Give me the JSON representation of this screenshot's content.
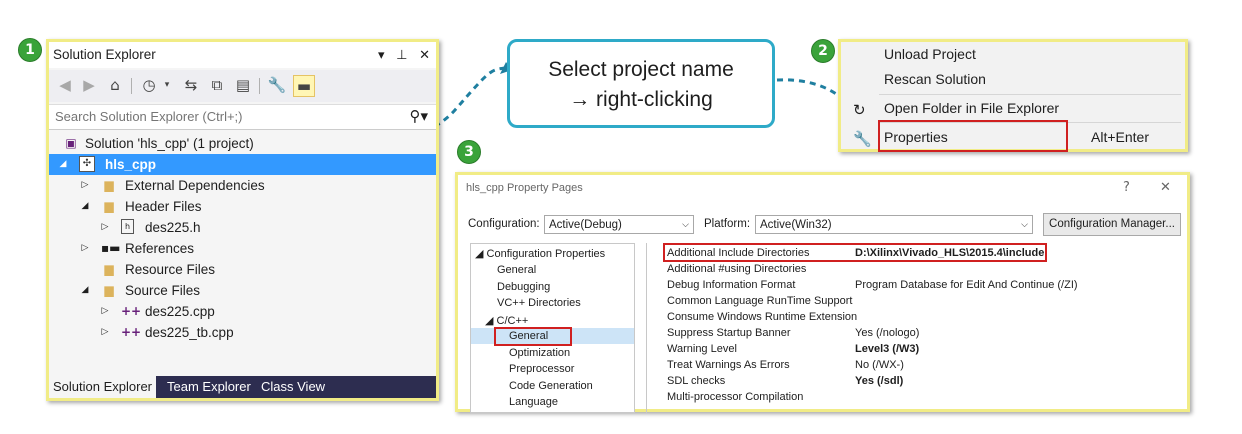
{
  "steps": [
    "1",
    "2",
    "3"
  ],
  "solution_explorer": {
    "title": "Solution Explorer",
    "title_icons": [
      "▾",
      "⊥",
      "✕"
    ],
    "search_placeholder": "Search Solution Explorer (Ctrl+;)",
    "tree": [
      {
        "label": "Solution 'hls_cpp' (1 project)",
        "icon": "solution-icon"
      },
      {
        "label": "hls_cpp",
        "icon": "project-icon",
        "selected": true
      },
      {
        "label": "External Dependencies",
        "icon": "folder-icon"
      },
      {
        "label": "Header Files",
        "icon": "folder-icon"
      },
      {
        "label": "des225.h",
        "icon": "header-file-icon"
      },
      {
        "label": "References",
        "icon": "references-icon"
      },
      {
        "label": "Resource Files",
        "icon": "folder-icon"
      },
      {
        "label": "Source Files",
        "icon": "folder-icon"
      },
      {
        "label": "des225.cpp",
        "icon": "cpp-file-icon"
      },
      {
        "label": "des225_tb.cpp",
        "icon": "cpp-file-icon"
      }
    ],
    "tabs": [
      "Solution Explorer",
      "Team Explorer",
      "Class View"
    ]
  },
  "callout": {
    "line1": "Select project name",
    "line2": "→ right-clicking"
  },
  "context_menu": {
    "items": [
      {
        "label": "Unload Project",
        "shortcut": ""
      },
      {
        "label": "Rescan Solution",
        "shortcut": ""
      },
      {
        "label": "Open Folder in File Explorer",
        "shortcut": ""
      },
      {
        "label": "Properties",
        "shortcut": "Alt+Enter"
      }
    ]
  },
  "property_pages": {
    "title": "hls_cpp Property Pages",
    "help": "?",
    "close": "✕",
    "configuration_label": "Configuration:",
    "configuration_value": "Active(Debug)",
    "platform_label": "Platform:",
    "platform_value": "Active(Win32)",
    "config_manager_button": "Configuration Manager...",
    "tree": [
      "Configuration Properties",
      "General",
      "Debugging",
      "VC++ Directories",
      "C/C++",
      "General",
      "Optimization",
      "Preprocessor",
      "Code Generation",
      "Language"
    ],
    "properties": [
      {
        "name": "Additional Include Directories",
        "value": "D:\\Xilinx\\Vivado_HLS\\2015.4\\include",
        "bold": true
      },
      {
        "name": "Additional #using Directories",
        "value": ""
      },
      {
        "name": "Debug Information Format",
        "value": "Program Database for Edit And Continue (/ZI)"
      },
      {
        "name": "Common Language RunTime Support",
        "value": ""
      },
      {
        "name": "Consume Windows Runtime Extension",
        "value": ""
      },
      {
        "name": "Suppress Startup Banner",
        "value": "Yes (/nologo)"
      },
      {
        "name": "Warning Level",
        "value": "Level3 (/W3)",
        "bold": true
      },
      {
        "name": "Treat Warnings As Errors",
        "value": "No (/WX-)"
      },
      {
        "name": "SDL checks",
        "value": "Yes (/sdl)",
        "bold": true
      },
      {
        "name": "Multi-processor Compilation",
        "value": ""
      }
    ]
  },
  "colors": {
    "frame_highlight": "#f1ec86",
    "step_badge": "#3aa33a",
    "callout_border": "#2eaac8",
    "selection": "#3399ff",
    "red_highlight": "#d02020"
  }
}
